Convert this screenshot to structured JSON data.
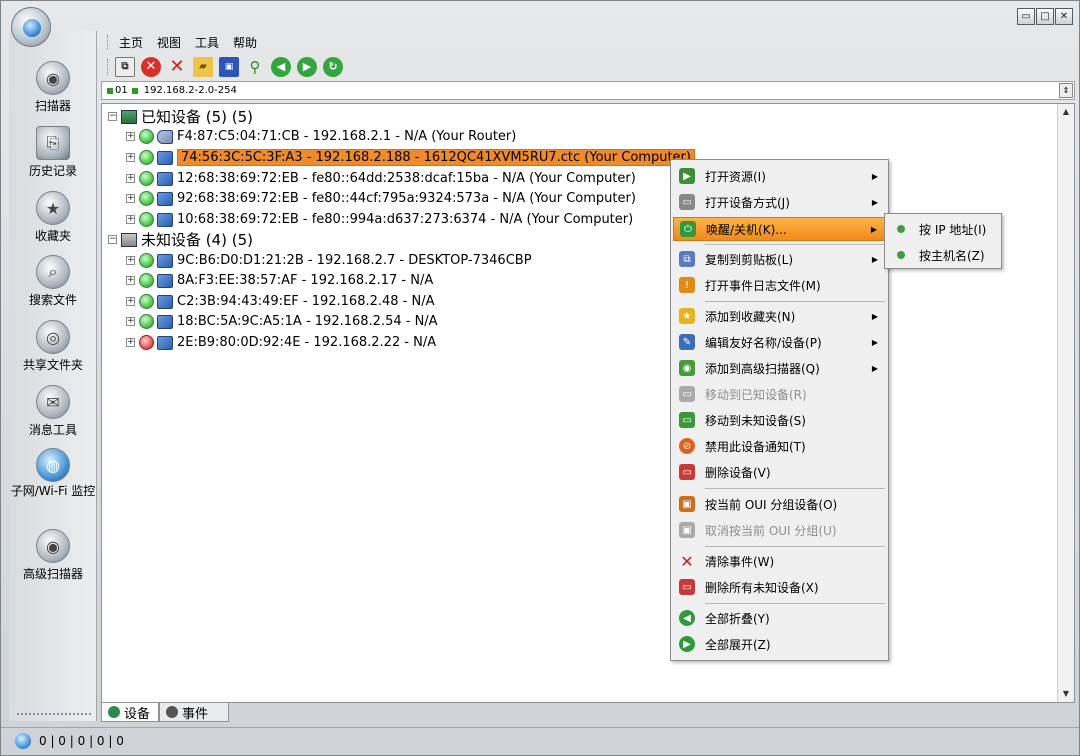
{
  "window": {
    "buttons": [
      "▭",
      "□",
      "✕"
    ]
  },
  "menubar": {
    "items": [
      "主页",
      "视图",
      "工具",
      "帮助"
    ]
  },
  "toolbar": {
    "icons": [
      "copy-icon",
      "stop-icon",
      "delete-icon",
      "open-icon",
      "save-icon",
      "find-icon",
      "back-icon",
      "forward-icon",
      "refresh-icon"
    ]
  },
  "address": {
    "prefix": "01",
    "value": "192.168.2-2.0-254"
  },
  "sidebar": {
    "items": [
      {
        "label": "扫描器",
        "icon": "scanner-icon"
      },
      {
        "label": "历史记录",
        "icon": "history-icon"
      },
      {
        "label": "收藏夹",
        "icon": "favorites-icon"
      },
      {
        "label": "搜索文件",
        "icon": "search-files-icon"
      },
      {
        "label": "共享文件夹",
        "icon": "shared-folder-icon"
      },
      {
        "label": "消息工具",
        "icon": "message-icon"
      },
      {
        "label": "子网/Wi-Fi 监控",
        "icon": "subnet-monitor-icon"
      },
      {
        "label": "高级扫描器",
        "icon": "advanced-scanner-icon"
      }
    ]
  },
  "tree": {
    "known": {
      "label": "已知设备 (5) (5)",
      "devices": [
        "F4:87:C5:04:71:CB - 192.168.2.1 - N/A (Your Router)",
        "74:56:3C:5C:3F:A3 - 192.168.2.188 - 1612QC41XVM5RU7.ctc (Your Computer)",
        "12:68:38:69:72:EB - fe80::64dd:2538:dcaf:15ba - N/A (Your Computer)",
        "92:68:38:69:72:EB - fe80::44cf:795a:9324:573a - N/A (Your Computer)",
        "10:68:38:69:72:EB - fe80::994a:d637:273:6374 - N/A (Your Computer)"
      ]
    },
    "unknown": {
      "label": "未知设备 (4) (5)",
      "devices": [
        "9C:B6:D0:D1:21:2B - 192.168.2.7 - DESKTOP-7346CBP",
        "8A:F3:EE:38:57:AF - 192.168.2.17 - N/A",
        "C2:3B:94:43:49:EF - 192.168.2.48 - N/A",
        "18:BC:5A:9C:A5:1A - 192.168.2.54 - N/A",
        "2E:B9:80:0D:92:4E - 192.168.2.22 - N/A"
      ]
    }
  },
  "context_menu": {
    "items": [
      {
        "label": "打开资源(I)",
        "submenu": true
      },
      {
        "label": "打开设备方式(J)",
        "submenu": true
      },
      {
        "label": "唤醒/关机(K)...",
        "submenu": true,
        "highlighted": true
      },
      {
        "label": "复制到剪贴板(L)",
        "submenu": true
      },
      {
        "label": "打开事件日志文件(M)"
      },
      {
        "label": "添加到收藏夹(N)",
        "submenu": true
      },
      {
        "label": "编辑友好名称/设备(P)",
        "submenu": true
      },
      {
        "label": "添加到高级扫描器(Q)",
        "submenu": true
      },
      {
        "label": "移动到已知设备(R)",
        "disabled": true
      },
      {
        "label": "移动到未知设备(S)"
      },
      {
        "label": "禁用此设备通知(T)"
      },
      {
        "label": "删除设备(V)"
      },
      {
        "label": "按当前 OUI 分组设备(O)"
      },
      {
        "label": "取消按当前 OUI 分组(U)",
        "disabled": true
      },
      {
        "label": "清除事件(W)"
      },
      {
        "label": "删除所有未知设备(X)"
      },
      {
        "label": "全部折叠(Y)"
      },
      {
        "label": "全部展开(Z)"
      }
    ]
  },
  "submenu": {
    "items": [
      "按 IP 地址(I)",
      "按主机名(Z)"
    ]
  },
  "tabs": {
    "devices": "设备",
    "events": "事件"
  },
  "status": {
    "text": "0 | 0 | 0 | 0 | 0"
  }
}
